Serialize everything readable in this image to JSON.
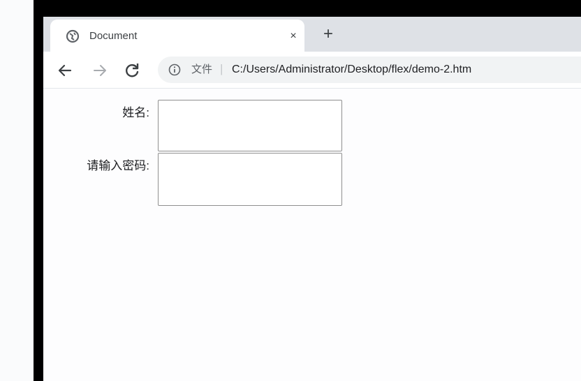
{
  "browser": {
    "tab": {
      "title": "Document",
      "close_glyph": "×",
      "favicon": "globe-icon"
    },
    "new_tab_glyph": "+",
    "toolbar": {
      "back_icon": "arrow-left-icon",
      "forward_icon": "arrow-right-icon",
      "reload_icon": "reload-icon"
    },
    "omnibox": {
      "info_icon": "info-icon",
      "scheme_label": "文件",
      "separator": "|",
      "url": "C:/Users/Administrator/Desktop/flex/demo-2.htm"
    }
  },
  "form": {
    "name": {
      "label": "姓名:",
      "value": ""
    },
    "password": {
      "label": "请输入密码:",
      "value": ""
    }
  }
}
